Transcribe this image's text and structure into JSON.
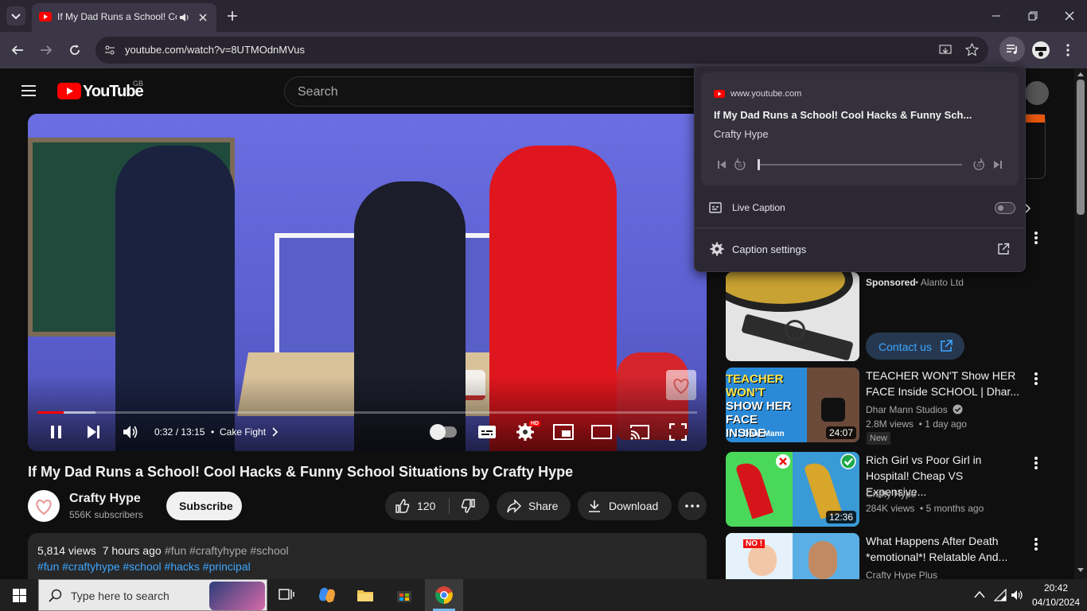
{
  "browser": {
    "tab_title": "If My Dad Runs a School! Cool Hacks & Funny School Situations by Crafty Hype",
    "url": "youtube.com/watch?v=8UTMOdnMVus"
  },
  "youtube": {
    "logo_text": "YouTube",
    "region": "GB",
    "search_placeholder": "Search"
  },
  "player": {
    "time": "0:32 / 13:15",
    "chapter_sep": "•",
    "chapter": "Cake Fight",
    "progress_fraction": 0.04,
    "hd_badge": "HD"
  },
  "video": {
    "title": "If My Dad Runs a School! Cool Hacks & Funny School Situations by Crafty Hype",
    "channel": "Crafty Hype",
    "subscribers": "556K subscribers",
    "subscribe_label": "Subscribe",
    "likes": "120",
    "share_label": "Share",
    "download_label": "Download",
    "desc_stats": "5,814 views  7 hours ago",
    "desc_tags_inline": "#fun #craftyhype #school",
    "desc_hashtags": "#fun #craftyhype #school #hacks #principal"
  },
  "sidebar": {
    "ad": {
      "sponsored": "Sponsored",
      "advertiser": "• Alanto Ltd",
      "cta": "Contact us"
    },
    "items": [
      {
        "title_line1": "TEACHER WON'T Show HER",
        "title_line2": "FACE Inside SCHOOL | Dhar...",
        "channel": "Dhar Mann Studios",
        "meta": "2.8M views  • 1 day ago",
        "badge": "New",
        "duration": "24:07",
        "thumb_text_1": "TEACHER WON'T",
        "thumb_text_2": "SHOW HER FACE",
        "thumb_text_3": "INSIDE SCHOOL",
        "thumb_brand": "Dhar Mann"
      },
      {
        "title_line1": "Rich Girl vs Poor Girl in",
        "title_line2": "Hospital! Cheap VS Expensive...",
        "channel": "Crafty Hype",
        "meta": "284K views  • 5 months ago",
        "duration": "12:36"
      },
      {
        "title_line1": "What Happens After Death",
        "title_line2": "*emotional*! Relatable And...",
        "channel": "Crafty Hype Plus",
        "thumb_text_1": "NO !"
      }
    ]
  },
  "media_popup": {
    "source": "www.youtube.com",
    "title": "If My Dad Runs a School! Cool Hacks & Funny Sch...",
    "artist": "Crafty Hype",
    "live_caption_label": "Live Caption",
    "caption_settings_label": "Caption settings",
    "live_caption_on": false
  },
  "taskbar": {
    "search_placeholder": "Type here to search",
    "time": "20:42",
    "date": "04/10/2024"
  },
  "colors": {
    "youtube_red": "#ff0000",
    "link_blue": "#3ea6ff",
    "chrome_dark": "#3c3747",
    "taskbar": "#202020"
  }
}
